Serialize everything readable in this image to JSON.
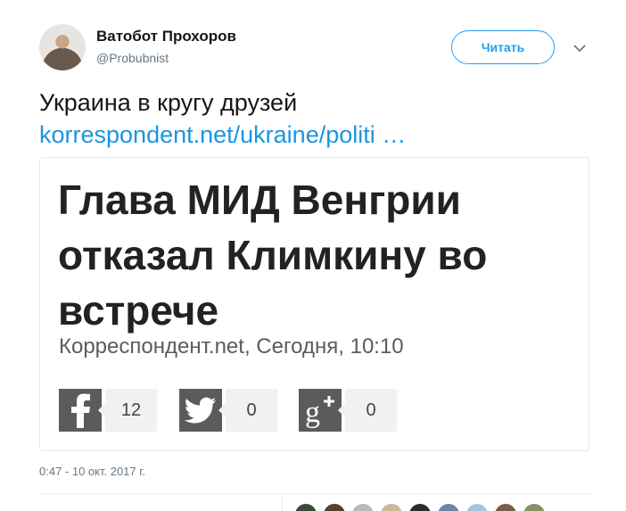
{
  "author": {
    "name": "Ватобот Прохоров",
    "handle": "@Probubnist"
  },
  "follow_button": {
    "label": "Читать"
  },
  "tweet": {
    "text": "Украина в кругу друзей",
    "link": "korrespondent.net/ukraine/politi   …"
  },
  "card": {
    "headline": "Глава МИД Венгрии отказал Климкину во встрече",
    "source": "Корреспондент.net, Сегодня, 10:10",
    "shares": [
      {
        "network": "facebook",
        "icon": "facebook-icon",
        "count": "12"
      },
      {
        "network": "twitter",
        "icon": "twitter-icon",
        "count": "0"
      },
      {
        "network": "google-plus",
        "icon": "google-plus-icon",
        "count": "0"
      }
    ]
  },
  "timestamp": "0:47 - 10 окт. 2017 г.",
  "colors": {
    "accent": "#1da1f2",
    "link": "#1b95e0",
    "muted": "#657786",
    "share_icon_bg": "#5b5b5b",
    "liker_avatars": [
      "#3b4a3a",
      "#5a3f33",
      "#b9b9b9",
      "#c9b89a",
      "#2d2d2d",
      "#6f86a8",
      "#a9c4d8",
      "#7a5c46",
      "#8a8f6a"
    ]
  }
}
